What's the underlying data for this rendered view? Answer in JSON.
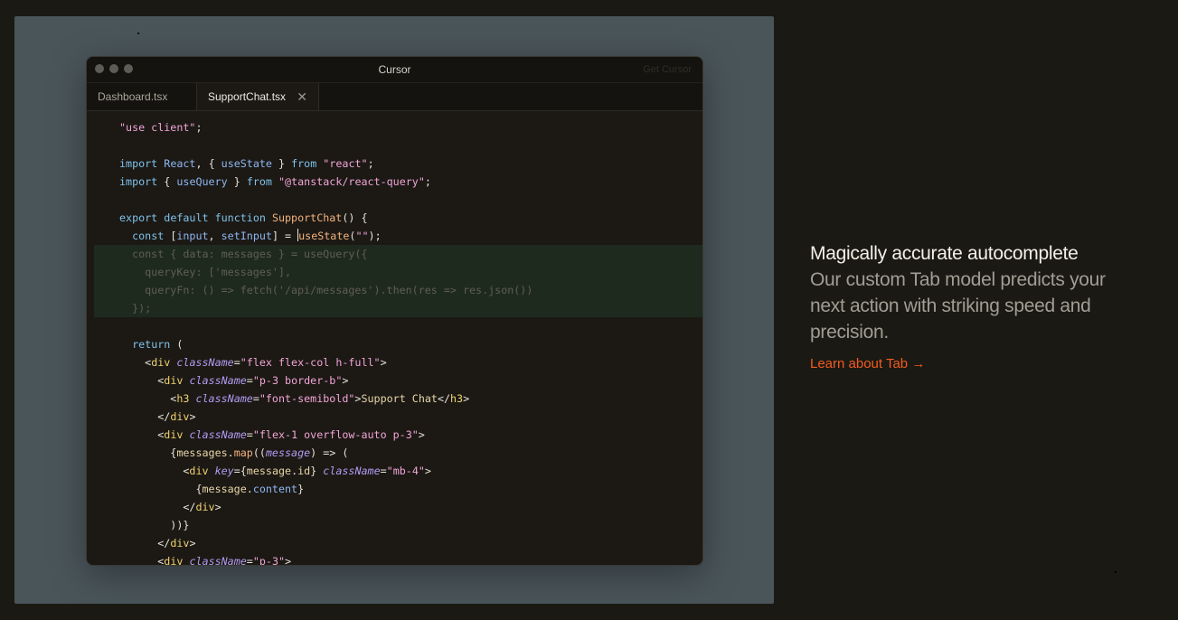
{
  "window": {
    "title": "Cursor",
    "get_cursor": "Get Cursor"
  },
  "tabs": [
    {
      "label": "Dashboard.tsx",
      "active": false
    },
    {
      "label": "SupportChat.tsx",
      "active": true,
      "close": "✕"
    }
  ],
  "code_lines": [
    "\"use client\";",
    "",
    "import React, { useState } from \"react\";",
    "import { useQuery } from \"@tanstack/react-query\";",
    "",
    "export default function SupportChat() {",
    "  const [input, setInput] = useState(\"\");",
    "  const { data: messages } = useQuery({",
    "    queryKey: ['messages'],",
    "    queryFn: () => fetch('/api/messages').then(res => res.json())",
    "  });",
    "",
    "  return (",
    "    <div className=\"flex flex-col h-full\">",
    "      <div className=\"p-3 border-b\">",
    "        <h3 className=\"font-semibold\">Support Chat</h3>",
    "      </div>",
    "      <div className=\"flex-1 overflow-auto p-3\">",
    "        {messages.map((message) => (",
    "          <div key={message.id} className=\"mb-4\">",
    "            {message.content}",
    "          </div>",
    "        ))}",
    "      </div>",
    "      <div className=\"p-3\">"
  ],
  "promo": {
    "heading": "Magically accurate autocomplete",
    "body": "Our custom Tab model predicts your next action with striking speed and precision.",
    "link": "Learn about Tab →"
  },
  "colors": {
    "accent": "#f15b22",
    "background": "#1b1913",
    "stage": "#4a555a"
  }
}
